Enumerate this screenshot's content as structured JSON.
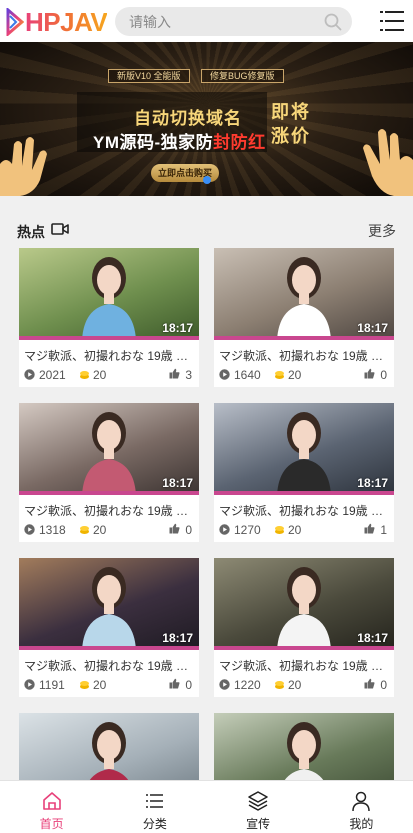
{
  "brand": {
    "logo_text": "HPJAV"
  },
  "search": {
    "placeholder": "请输入",
    "icon": "search-icon"
  },
  "menu": {
    "icon": "menu-list-icon"
  },
  "banner": {
    "tag_left": "新版V10 全能版",
    "tag_right": "修复BUG修复版",
    "line1": "自动切换域名",
    "line2_prefix": "YM源码-独家防",
    "line2_highlight": "封防红",
    "side_line1": "即将",
    "side_line2": "涨价",
    "button": "立即点击购买"
  },
  "section": {
    "title": "热点",
    "icon": "video-camera-icon",
    "more": "更多"
  },
  "videos": [
    {
      "title": "マジ軟派、初撮れおな 19歳 …",
      "duration": "18:17",
      "views": "2021",
      "coins": "20",
      "likes": "3"
    },
    {
      "title": "マジ軟派、初撮れおな 19歳 …",
      "duration": "18:17",
      "views": "1640",
      "coins": "20",
      "likes": "0"
    },
    {
      "title": "マジ軟派、初撮れおな 19歳 …",
      "duration": "18:17",
      "views": "1318",
      "coins": "20",
      "likes": "0"
    },
    {
      "title": "マジ軟派、初撮れおな 19歳 …",
      "duration": "18:17",
      "views": "1270",
      "coins": "20",
      "likes": "1"
    },
    {
      "title": "マジ軟派、初撮れおな 19歳 …",
      "duration": "18:17",
      "views": "1191",
      "coins": "20",
      "likes": "0"
    },
    {
      "title": "マジ軟派、初撮れおな 19歳 …",
      "duration": "18:17",
      "views": "1220",
      "coins": "20",
      "likes": "0"
    },
    {
      "title": "",
      "duration": "",
      "views": "",
      "coins": "",
      "likes": ""
    },
    {
      "title": "",
      "duration": "",
      "views": "",
      "coins": "",
      "likes": ""
    }
  ],
  "tabs": [
    {
      "label": "首页",
      "icon": "home-icon",
      "active": true
    },
    {
      "label": "分类",
      "icon": "list-icon",
      "active": false
    },
    {
      "label": "宣传",
      "icon": "layers-icon",
      "active": false
    },
    {
      "label": "我的",
      "icon": "user-icon",
      "active": false
    }
  ],
  "colors": {
    "accent": "#e8407a",
    "strip": "#c9478f",
    "gold": "#f7d67a"
  }
}
